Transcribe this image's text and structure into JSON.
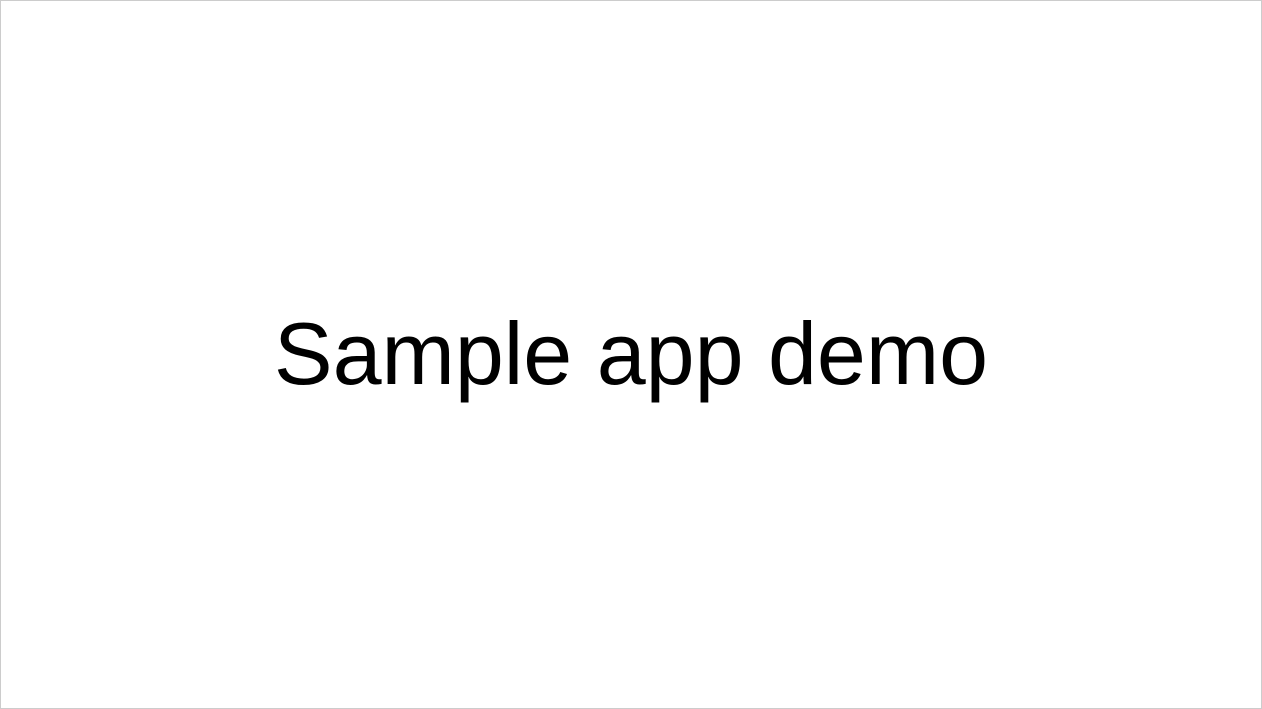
{
  "slide": {
    "title": "Sample app demo"
  }
}
